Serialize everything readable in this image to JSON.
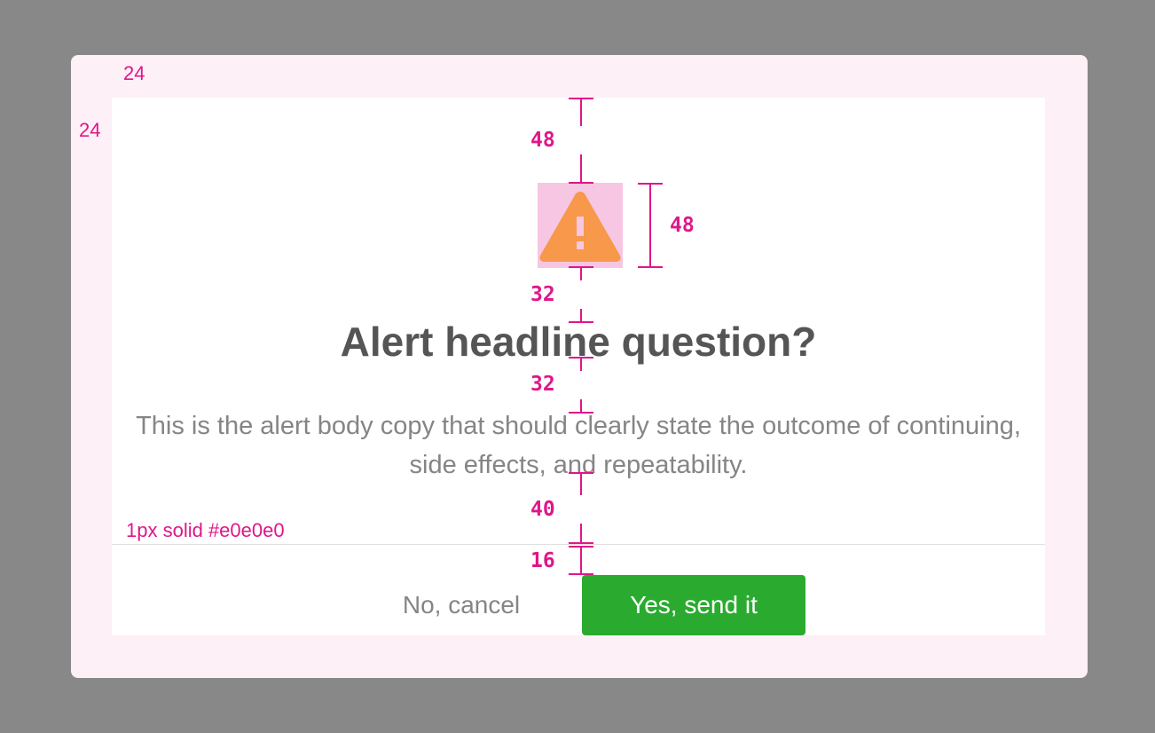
{
  "annotations": {
    "outer_padding_top": "24",
    "outer_padding_left": "24",
    "icon_top_spacing": "48",
    "icon_size": "48",
    "icon_bottom_spacing": "32",
    "headline_bottom_spacing": "32",
    "body_bottom_spacing": "40",
    "divider_bottom_spacing": "16",
    "divider_spec": "1px solid #e0e0e0"
  },
  "dialog": {
    "icon": "warning-icon",
    "headline": "Alert headline question?",
    "body": "This is the alert body copy that should clearly state the outcome of continuing, side effects, and repeatability.",
    "cancel_label": "No, cancel",
    "confirm_label": "Yes, send it"
  },
  "colors": {
    "backdrop": "#888888",
    "padding_area": "#fdf0f7",
    "annotation": "#e0168a",
    "icon_box": "#f7c6e2",
    "warning": "#f7984a",
    "headline": "#555555",
    "body": "#858585",
    "divider": "#e0e0e0",
    "confirm_button": "#2aab30"
  }
}
